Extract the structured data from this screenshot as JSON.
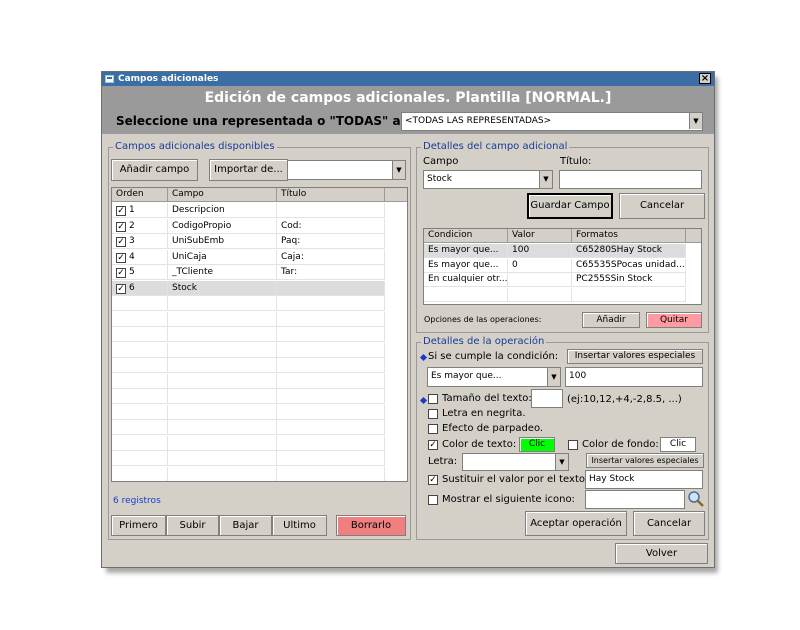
{
  "window": {
    "title": "Campos adicionales",
    "heading": "Edición de campos adicionales. Plantilla [NORMAL.]",
    "select_label": "Seleccione una representada o \"TODAS\" aquí:",
    "select_value": "<TODAS LAS REPRESENTADAS>"
  },
  "left": {
    "legend": "Campos adicionales disponibles",
    "add_button": "Añadir campo",
    "import_button": "Importar de...",
    "import_combo_value": "",
    "columns": [
      "Orden",
      "Campo",
      "Título"
    ],
    "rows": [
      {
        "orden": "1",
        "campo": "Descripcion",
        "titulo": "",
        "checked": true
      },
      {
        "orden": "2",
        "campo": "CodigoPropio",
        "titulo": "Cod:",
        "checked": true
      },
      {
        "orden": "3",
        "campo": "UniSubEmb",
        "titulo": "Paq:",
        "checked": true
      },
      {
        "orden": "4",
        "campo": "UniCaja",
        "titulo": "Caja:",
        "checked": true
      },
      {
        "orden": "5",
        "campo": "_TCliente",
        "titulo": "Tar:",
        "checked": true
      },
      {
        "orden": "6",
        "campo": "Stock",
        "titulo": "",
        "checked": true
      }
    ],
    "record_count": "6 registros",
    "buttons": {
      "first": "Primero",
      "up": "Subir",
      "down": "Bajar",
      "last": "Ultimo",
      "delete": "Borrarlo"
    }
  },
  "details": {
    "legend": "Detalles del campo adicional",
    "campo_label": "Campo",
    "campo_value": "Stock",
    "titulo_label": "Título:",
    "titulo_value": "",
    "save_button": "Guardar Campo",
    "cancel_button": "Cancelar",
    "columns": [
      "Condicion",
      "Valor",
      "Formatos"
    ],
    "rows": [
      {
        "condicion": "Es mayor que...",
        "valor": "100",
        "formatos": "C65280SHay Stock"
      },
      {
        "condicion": "Es mayor que...",
        "valor": "0",
        "formatos": "C65535SPocas unidad..."
      },
      {
        "condicion": "En cualquier otr...",
        "valor": "",
        "formatos": "PC255SSin Stock"
      }
    ],
    "ops_label": "Opciones de las operaciones:",
    "add_op_button": "Añadir",
    "remove_op_button": "Quitar"
  },
  "operation": {
    "legend": "Detalles de la operación",
    "condition_label": "Si se cumple la condición:",
    "insert_special_button": "Insertar valores especiales",
    "condition_value": "Es mayor que...",
    "condition_input": "100",
    "text_size_label": "Tamaño del texto:",
    "text_size_value": "",
    "text_size_hint": "(ej:10,12,+4,-2,8.5, ...)",
    "bold_label": "Letra en negrita.",
    "blink_label": "Efecto de parpadeo.",
    "text_color_label": "Color de texto:",
    "text_color_button": "Clic",
    "bg_color_label": "Color de fondo:",
    "bg_color_button": "Clic",
    "font_label": "Letra:",
    "font_value": "",
    "insert_special_button2": "Insertar valores especiales",
    "replace_label": "Sustituir el valor por el texto:",
    "replace_value": "Hay Stock",
    "icon_label": "Mostrar el siguiente icono:",
    "icon_value": "",
    "accept_button": "Aceptar operación",
    "cancel_button": "Cancelar",
    "checks": {
      "size": false,
      "bold": false,
      "blink": false,
      "text_color": true,
      "bg_color": false,
      "replace": true,
      "icon": false
    }
  },
  "footer": {
    "back_button": "Volver"
  },
  "colors": {
    "titlebar": "#3a6ea5",
    "header_band": "#9a9a9a",
    "legend_text": "#1a3a9a",
    "delete_button": "#f08080",
    "quitar_button": "#ff9aa0",
    "text_color_swatch": "#00ff00",
    "selected_row": "#dcdcdc"
  },
  "icons": {
    "app": "app-icon",
    "close": "close-icon",
    "search": "search-icon"
  }
}
